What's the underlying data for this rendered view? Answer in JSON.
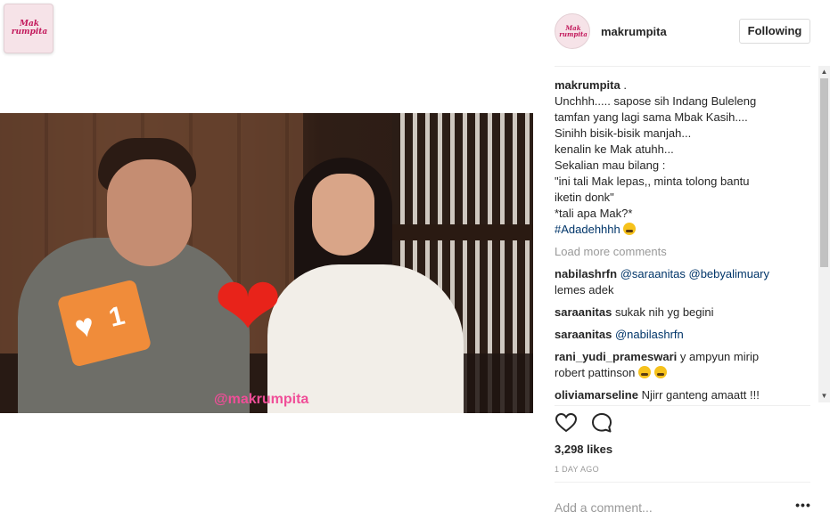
{
  "profile": {
    "username": "makrumpita",
    "follow_label": "Following",
    "logo_text": "Mak rumpita"
  },
  "video": {
    "heart_overlay_count": "1",
    "watermark": "@makrumpita"
  },
  "caption": {
    "author": "makrumpita",
    "after_author": " .",
    "lines": [
      "Unchhh..... sapose sih Indang Buleleng",
      "tamfan yang lagi sama Mbak Kasih....",
      "Sinihh bisik-bisik manjah...",
      "kenalin ke Mak atuhh...",
      "Sekalian mau bilang :",
      "\"ini tali Mak lepas,, minta tolong bantu",
      "iketin donk\"",
      "*tali apa Mak?*"
    ],
    "hashtag": "#Adadehhhh",
    "hashtag_emoji": "grinning-sweat-emoji"
  },
  "load_more_label": "Load more comments",
  "comments": [
    {
      "user": "nabilashrfn",
      "mentions": "@saraanitas @bebyalimuary",
      "text": "lemes adek"
    },
    {
      "user": "saraanitas",
      "text": "sukak nih yg begini"
    },
    {
      "user": "saraanitas",
      "mentions": "@nabilashrfn"
    },
    {
      "user": "rani_yudi_prameswari",
      "text": "y ampyun mirip",
      "text2": "robert pattinson",
      "emojis": [
        "sad-emoji",
        "grinning-sweat-emoji"
      ]
    },
    {
      "user": "oliviamarseline",
      "text": "Njirr ganteng amaatt !!!"
    }
  ],
  "actions": {
    "like_icon": "heart-icon",
    "comment_icon": "speech-bubble-icon"
  },
  "likes_text": "3,298 likes",
  "date_text": "1 DAY AGO",
  "add_comment": {
    "placeholder": "Add a comment...",
    "more_icon": "ellipsis-icon",
    "more_label": "•••"
  },
  "colors": {
    "link": "#003569",
    "muted": "#999999",
    "text": "#262626",
    "watermark_pink": "#f04e98",
    "notif_orange": "#f08c3a"
  }
}
